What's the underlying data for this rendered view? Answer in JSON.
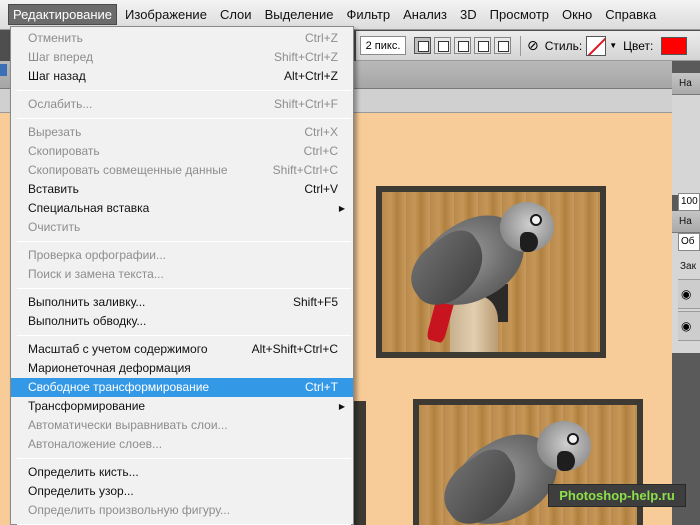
{
  "menubar": {
    "items": [
      "Редактирование",
      "Изображение",
      "Слои",
      "Выделение",
      "Фильтр",
      "Анализ",
      "3D",
      "Просмотр",
      "Окно",
      "Справка"
    ]
  },
  "options": {
    "stroke_width": "2 пикс.",
    "style_label": "Стиль:",
    "color_label": "Цвет:",
    "color_value": "#ff0000"
  },
  "edit_menu": {
    "items": [
      {
        "label": "Отменить",
        "shortcut": "Ctrl+Z",
        "state": "disabled"
      },
      {
        "label": "Шаг вперед",
        "shortcut": "Shift+Ctrl+Z",
        "state": "disabled"
      },
      {
        "label": "Шаг назад",
        "shortcut": "Alt+Ctrl+Z",
        "state": "enabled"
      },
      {
        "label": "Ослабить...",
        "shortcut": "Shift+Ctrl+F",
        "state": "disabled"
      },
      {
        "label": "Вырезать",
        "shortcut": "Ctrl+X",
        "state": "disabled"
      },
      {
        "label": "Скопировать",
        "shortcut": "Ctrl+C",
        "state": "disabled"
      },
      {
        "label": "Скопировать совмещенные данные",
        "shortcut": "Shift+Ctrl+C",
        "state": "disabled"
      },
      {
        "label": "Вставить",
        "shortcut": "Ctrl+V",
        "state": "enabled"
      },
      {
        "label": "Специальная вставка",
        "shortcut": "",
        "state": "enabled"
      },
      {
        "label": "Очистить",
        "shortcut": "",
        "state": "disabled"
      },
      {
        "label": "Проверка орфографии...",
        "shortcut": "",
        "state": "disabled"
      },
      {
        "label": "Поиск и замена текста...",
        "shortcut": "",
        "state": "disabled"
      },
      {
        "label": "Выполнить заливку...",
        "shortcut": "Shift+F5",
        "state": "enabled"
      },
      {
        "label": "Выполнить обводку...",
        "shortcut": "",
        "state": "enabled"
      },
      {
        "label": "Масштаб с учетом содержимого",
        "shortcut": "Alt+Shift+Ctrl+C",
        "state": "enabled"
      },
      {
        "label": "Марионеточная деформация",
        "shortcut": "",
        "state": "enabled"
      },
      {
        "label": "Свободное трансформирование",
        "shortcut": "Ctrl+T",
        "state": "highlighted"
      },
      {
        "label": "Трансформирование",
        "shortcut": "",
        "state": "enabled"
      },
      {
        "label": "Автоматически выравнивать слои...",
        "shortcut": "",
        "state": "disabled"
      },
      {
        "label": "Автоналожение слоев...",
        "shortcut": "",
        "state": "disabled"
      },
      {
        "label": "Определить кисть...",
        "shortcut": "",
        "state": "enabled"
      },
      {
        "label": "Определить узор...",
        "shortcut": "",
        "state": "enabled"
      },
      {
        "label": "Определить произвольную фигуру...",
        "shortcut": "",
        "state": "disabled"
      }
    ]
  },
  "right_panel": {
    "nav_tab": "На",
    "zoom": "100",
    "layers_tab": "На",
    "blend": "Об",
    "lock": "Зак"
  },
  "watermark": "Photoshop-help.ru"
}
